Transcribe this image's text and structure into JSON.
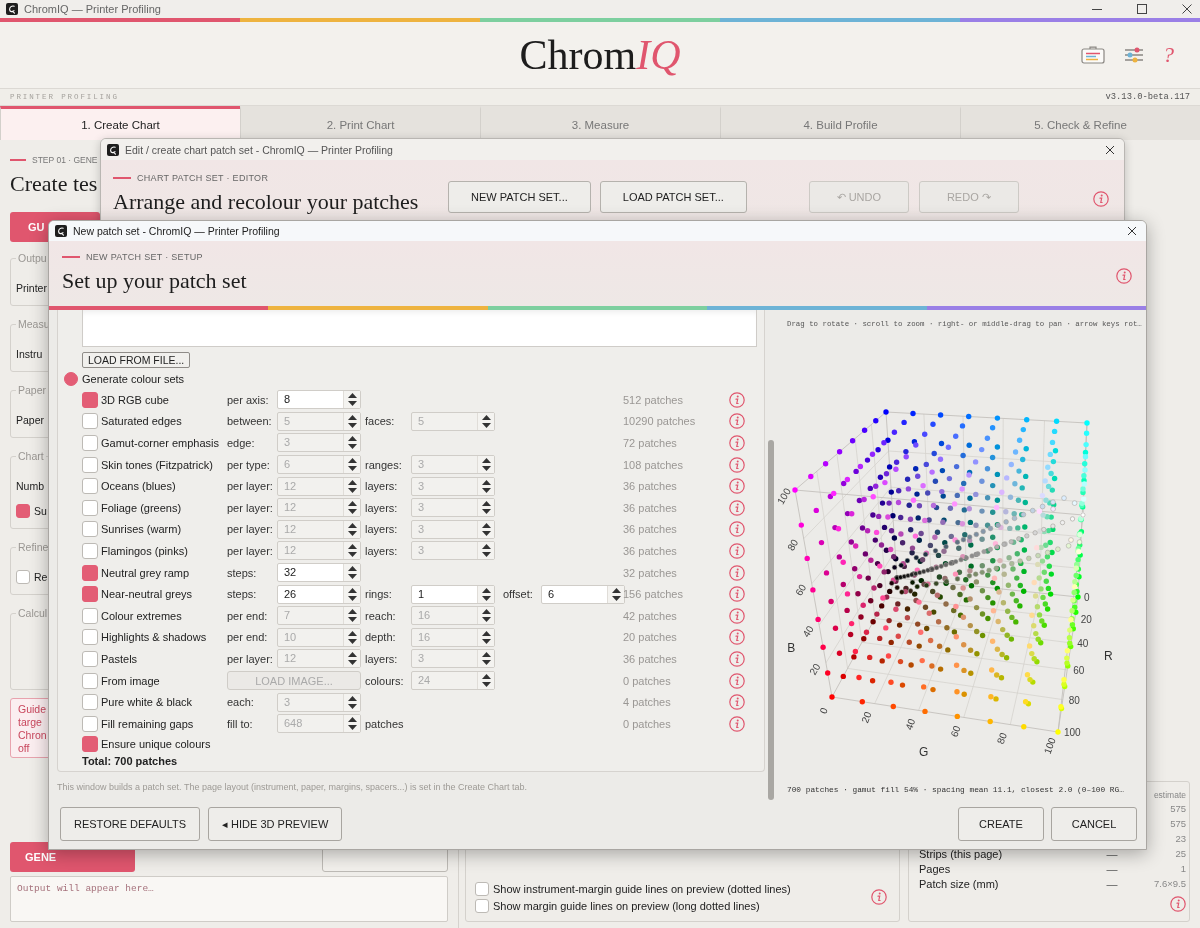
{
  "window": {
    "title": "ChromIQ — Printer Profiling"
  },
  "header": {
    "logo": "Chrom",
    "logo_accent": "IQ",
    "help": "?",
    "subtitle": "PRINTER PROFILING",
    "version": "v3.13.0-beta.117"
  },
  "tabs": [
    {
      "label": "1. Create Chart",
      "selected": true
    },
    {
      "label": "2. Print Chart",
      "selected": false
    },
    {
      "label": "3. Measure",
      "selected": false
    },
    {
      "label": "4. Build Profile",
      "selected": false
    },
    {
      "label": "5. Check & Refine",
      "selected": false
    }
  ],
  "create_chart": {
    "step": "STEP 01 · GENE",
    "title": "Create tes",
    "guide_button": "GU",
    "groups": [
      {
        "legend": "Outpu",
        "items": [
          {
            "kind": "text",
            "text": "Printer"
          }
        ]
      },
      {
        "legend": "Measu",
        "items": [
          {
            "kind": "text",
            "text": "Instru"
          }
        ]
      },
      {
        "legend": "Paper",
        "items": [
          {
            "kind": "text",
            "text": "Paper"
          }
        ]
      },
      {
        "legend": "Chart",
        "items": [
          {
            "kind": "text",
            "text": "Numb"
          },
          {
            "kind": "checkbox",
            "text": "Su",
            "checked": true
          }
        ]
      },
      {
        "legend": "Refine",
        "items": [
          {
            "kind": "checkbox",
            "text": "Re",
            "checked": false
          }
        ]
      },
      {
        "legend": "Calcul"
      }
    ],
    "note": [
      "Guide",
      "targe",
      "Chron",
      "off"
    ],
    "generate_button": "GENE",
    "output": {
      "placeholder": "Output will appear here…"
    }
  },
  "preview_options": [
    {
      "label": "Show instrument-margin guide lines on preview (dotted lines)",
      "checked": false
    },
    {
      "label": "Show margin guide lines on preview (long dotted lines)",
      "checked": false
    }
  ],
  "summary": {
    "header": "estimate",
    "rows": [
      {
        "value": "575"
      },
      {
        "value": "575"
      },
      {
        "value": "23"
      },
      {
        "label": "Strips (this page)",
        "dash": "—",
        "value": "25"
      },
      {
        "label": "Pages",
        "dash": "—",
        "value": "1"
      },
      {
        "label": "Patch size (mm)",
        "dash": "—",
        "value": "7.6×9.5"
      }
    ]
  },
  "editor": {
    "title": "Edit / create chart patch set - ChromIQ — Printer Profiling",
    "eyebrow": "CHART PATCH SET · EDITOR",
    "heading": "Arrange and recolour your patches",
    "actions": [
      {
        "label": "NEW PATCH SET...",
        "disabled": false
      },
      {
        "label": "LOAD PATCH SET...",
        "disabled": false
      }
    ],
    "history": [
      {
        "label": "↶ UNDO",
        "disabled": true
      },
      {
        "label": "REDO ↷",
        "disabled": true
      }
    ]
  },
  "setup": {
    "title": "New patch set - ChromIQ — Printer Profiling",
    "eyebrow": "NEW PATCH SET · SETUP",
    "heading": "Set up your patch set",
    "load_button": "LOAD FROM FILE...",
    "generate": {
      "label": "Generate colour sets",
      "selected": true
    },
    "sets": [
      {
        "label": "3D RGB cube",
        "checked": true,
        "params": [
          {
            "kind": "spinner",
            "label": "per axis:",
            "value": "8"
          }
        ],
        "count": "512 patches"
      },
      {
        "label": "Saturated edges",
        "checked": false,
        "params": [
          {
            "kind": "spinner",
            "label": "between:",
            "value": "5"
          },
          {
            "kind": "spinner",
            "label": "faces:",
            "value": "5"
          }
        ],
        "count": "10290 patches"
      },
      {
        "label": "Gamut-corner emphasis",
        "checked": false,
        "params": [
          {
            "kind": "spinner",
            "label": "edge:",
            "value": "3"
          }
        ],
        "count": "72 patches"
      },
      {
        "label": "Skin tones (Fitzpatrick)",
        "checked": false,
        "params": [
          {
            "kind": "spinner",
            "label": "per type:",
            "value": "6"
          },
          {
            "kind": "spinner",
            "label": "ranges:",
            "value": "3"
          }
        ],
        "count": "108 patches"
      },
      {
        "label": "Oceans (blues)",
        "checked": false,
        "params": [
          {
            "kind": "spinner",
            "label": "per layer:",
            "value": "12"
          },
          {
            "kind": "spinner",
            "label": "layers:",
            "value": "3"
          }
        ],
        "count": "36 patches"
      },
      {
        "label": "Foliage (greens)",
        "checked": false,
        "params": [
          {
            "kind": "spinner",
            "label": "per layer:",
            "value": "12"
          },
          {
            "kind": "spinner",
            "label": "layers:",
            "value": "3"
          }
        ],
        "count": "36 patches"
      },
      {
        "label": "Sunrises (warm)",
        "checked": false,
        "params": [
          {
            "kind": "spinner",
            "label": "per layer:",
            "value": "12"
          },
          {
            "kind": "spinner",
            "label": "layers:",
            "value": "3"
          }
        ],
        "count": "36 patches"
      },
      {
        "label": "Flamingos (pinks)",
        "checked": false,
        "params": [
          {
            "kind": "spinner",
            "label": "per layer:",
            "value": "12"
          },
          {
            "kind": "spinner",
            "label": "layers:",
            "value": "3"
          }
        ],
        "count": "36 patches"
      },
      {
        "label": "Neutral grey ramp",
        "checked": true,
        "params": [
          {
            "kind": "spinner",
            "label": "steps:",
            "value": "32"
          }
        ],
        "count": "32 patches"
      },
      {
        "label": "Near-neutral greys",
        "checked": true,
        "params": [
          {
            "kind": "spinner",
            "label": "steps:",
            "value": "26"
          },
          {
            "kind": "spinner",
            "label": "rings:",
            "value": "1"
          },
          {
            "kind": "spinner",
            "label": "offset:",
            "value": "6"
          }
        ],
        "count": "156 patches"
      },
      {
        "label": "Colour extremes",
        "checked": false,
        "params": [
          {
            "kind": "spinner",
            "label": "per end:",
            "value": "7"
          },
          {
            "kind": "spinner",
            "label": "reach:",
            "value": "16"
          }
        ],
        "count": "42 patches"
      },
      {
        "label": "Highlights & shadows",
        "checked": false,
        "params": [
          {
            "kind": "spinner",
            "label": "per end:",
            "value": "10"
          },
          {
            "kind": "spinner",
            "label": "depth:",
            "value": "16"
          }
        ],
        "count": "20 patches"
      },
      {
        "label": "Pastels",
        "checked": false,
        "params": [
          {
            "kind": "spinner",
            "label": "per layer:",
            "value": "12"
          },
          {
            "kind": "spinner",
            "label": "layers:",
            "value": "3"
          }
        ],
        "count": "36 patches"
      },
      {
        "label": "From image",
        "checked": false,
        "params": [
          {
            "kind": "button",
            "label": "LOAD IMAGE..."
          },
          {
            "kind": "spinner",
            "label": "colours:",
            "value": "24"
          }
        ],
        "count": "0 patches"
      },
      {
        "label": "Pure white & black",
        "checked": false,
        "params": [
          {
            "kind": "spinner",
            "label": "each:",
            "value": "3"
          }
        ],
        "count": "4 patches"
      },
      {
        "label": "Fill remaining gaps",
        "checked": false,
        "params": [
          {
            "kind": "spinner",
            "label": "fill to:",
            "value": "648"
          },
          {
            "kind": "text",
            "label": "patches"
          }
        ],
        "count": "0 patches"
      }
    ],
    "unique": {
      "label": "Ensure unique colours",
      "checked": true
    },
    "total": "Total: 700 patches",
    "footnote": "This window builds a patch set. The page layout (instrument, paper, margins, spacers...) is set in the Create Chart tab.",
    "preview": {
      "hint": "Drag to rotate · scroll to zoom · right- or middle-drag to pan · arrow keys rot…",
      "axes": [
        {
          "kind": "b",
          "name": "B",
          "ticks": [
            "20",
            "40",
            "60",
            "80",
            "100"
          ]
        },
        {
          "kind": "g",
          "name": "G",
          "ticks": [
            "0",
            "20",
            "40",
            "60",
            "80",
            "100"
          ]
        },
        {
          "kind": "r",
          "name": "R",
          "ticks": [
            "0",
            "20",
            "40",
            "60",
            "80",
            "100"
          ]
        }
      ],
      "stats": "700 patches · gamut fill 54% · spacing mean 11.1, closest 2.0 (0–100 RG…"
    },
    "left_buttons": [
      "RESTORE DEFAULTS",
      "◂ HIDE 3D PREVIEW"
    ],
    "right_buttons": [
      "CREATE",
      "CANCEL"
    ]
  }
}
